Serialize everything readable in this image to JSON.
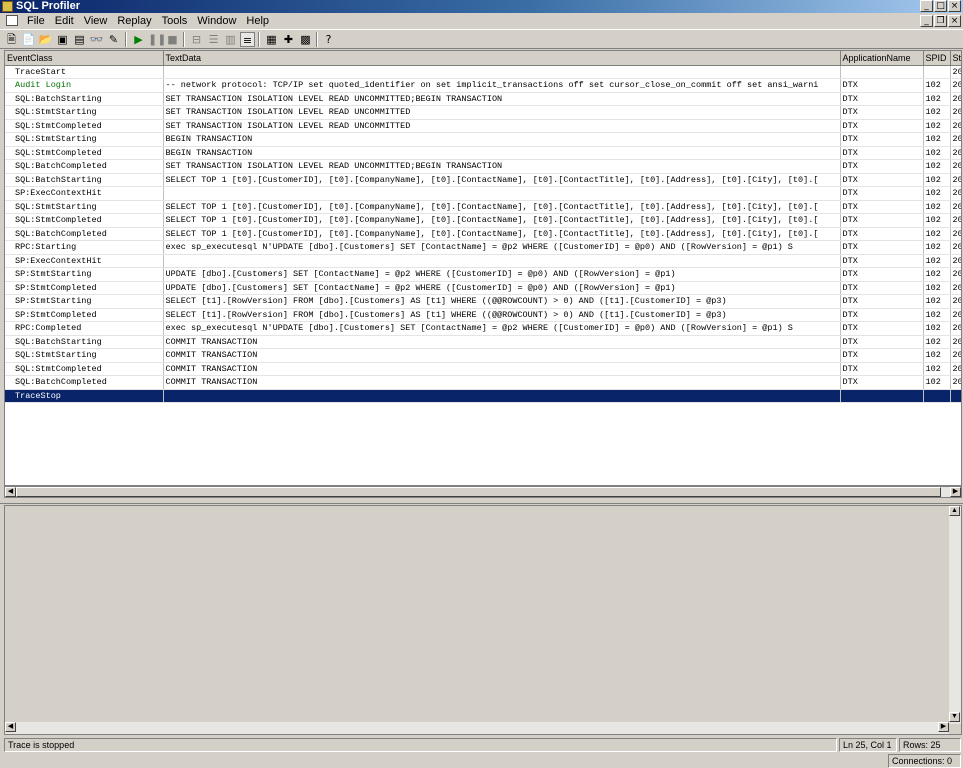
{
  "window": {
    "title": "SQL Profiler"
  },
  "menu": [
    "File",
    "Edit",
    "View",
    "Replay",
    "Tools",
    "Window",
    "Help"
  ],
  "toolbar": {
    "icons": [
      "new-trace-icon",
      "new-template-icon",
      "open-icon",
      "save-icon",
      "properties-icon",
      "find-icon",
      "clear-icon",
      "start-icon",
      "pause-icon",
      "stop-icon",
      "step-icon",
      "group-icon",
      "ungroup-icon",
      "auto-scroll-icon",
      "query-analyzer-icon",
      "perfmon-icon",
      "clear-window-icon",
      "help-icon"
    ]
  },
  "grid": {
    "columns": [
      "EventClass",
      "TextData",
      "ApplicationName",
      "SPID",
      "St"
    ],
    "rows": [
      {
        "event": "TraceStart",
        "text": "",
        "app": "",
        "spid": "",
        "st": "20"
      },
      {
        "event": "Audit Login",
        "text": "-- network protocol: TCP/IP set quoted_identifier on set implicit_transactions off set cursor_close_on_commit off set ansi_warni",
        "app": "DTX",
        "spid": "102",
        "st": "20"
      },
      {
        "event": "SQL:BatchStarting",
        "text": "SET TRANSACTION ISOLATION LEVEL READ UNCOMMITTED;BEGIN TRANSACTION",
        "app": "DTX",
        "spid": "102",
        "st": "20"
      },
      {
        "event": "SQL:StmtStarting",
        "text": "SET TRANSACTION ISOLATION LEVEL READ UNCOMMITTED",
        "app": "DTX",
        "spid": "102",
        "st": "20"
      },
      {
        "event": "SQL:StmtCompleted",
        "text": "SET TRANSACTION ISOLATION LEVEL READ UNCOMMITTED",
        "app": "DTX",
        "spid": "102",
        "st": "20"
      },
      {
        "event": "SQL:StmtStarting",
        "text": "BEGIN TRANSACTION",
        "app": "DTX",
        "spid": "102",
        "st": "20"
      },
      {
        "event": "SQL:StmtCompleted",
        "text": "BEGIN TRANSACTION",
        "app": "DTX",
        "spid": "102",
        "st": "20"
      },
      {
        "event": "SQL:BatchCompleted",
        "text": "SET TRANSACTION ISOLATION LEVEL READ UNCOMMITTED;BEGIN TRANSACTION",
        "app": "DTX",
        "spid": "102",
        "st": "20"
      },
      {
        "event": "SQL:BatchStarting",
        "text": "SELECT TOP 1 [t0].[CustomerID], [t0].[CompanyName], [t0].[ContactName], [t0].[ContactTitle], [t0].[Address], [t0].[City], [t0].[",
        "app": "DTX",
        "spid": "102",
        "st": "20"
      },
      {
        "event": "SP:ExecContextHit",
        "text": "",
        "app": "DTX",
        "spid": "102",
        "st": "20"
      },
      {
        "event": "SQL:StmtStarting",
        "text": "SELECT TOP 1 [t0].[CustomerID], [t0].[CompanyName], [t0].[ContactName], [t0].[ContactTitle], [t0].[Address], [t0].[City], [t0].[",
        "app": "DTX",
        "spid": "102",
        "st": "20"
      },
      {
        "event": "SQL:StmtCompleted",
        "text": "SELECT TOP 1 [t0].[CustomerID], [t0].[CompanyName], [t0].[ContactName], [t0].[ContactTitle], [t0].[Address], [t0].[City], [t0].[",
        "app": "DTX",
        "spid": "102",
        "st": "20"
      },
      {
        "event": "SQL:BatchCompleted",
        "text": "SELECT TOP 1 [t0].[CustomerID], [t0].[CompanyName], [t0].[ContactName], [t0].[ContactTitle], [t0].[Address], [t0].[City], [t0].[",
        "app": "DTX",
        "spid": "102",
        "st": "20"
      },
      {
        "event": "RPC:Starting",
        "text": "exec sp_executesql N'UPDATE [dbo].[Customers]  SET [ContactName] = @p2  WHERE ([CustomerID] = @p0) AND ([RowVersion] = @p1)    S",
        "app": "DTX",
        "spid": "102",
        "st": "20"
      },
      {
        "event": "SP:ExecContextHit",
        "text": "",
        "app": "DTX",
        "spid": "102",
        "st": "20"
      },
      {
        "event": "SP:StmtStarting",
        "text": "UPDATE [dbo].[Customers]  SET [ContactName] = @p2  WHERE ([CustomerID] = @p0) AND ([RowVersion] = @p1)",
        "app": "DTX",
        "spid": "102",
        "st": "20"
      },
      {
        "event": "SP:StmtCompleted",
        "text": "UPDATE [dbo].[Customers]  SET [ContactName] = @p2  WHERE ([CustomerID] = @p0) AND ([RowVersion] = @p1)",
        "app": "DTX",
        "spid": "102",
        "st": "20"
      },
      {
        "event": "SP:StmtStarting",
        "text": "SELECT [t1].[RowVersion]  FROM [dbo].[Customers] AS [t1]  WHERE ((@@ROWCOUNT) > 0) AND ([t1].[CustomerID] = @p3)",
        "app": "DTX",
        "spid": "102",
        "st": "20"
      },
      {
        "event": "SP:StmtCompleted",
        "text": "SELECT [t1].[RowVersion]  FROM [dbo].[Customers] AS [t1]  WHERE ((@@ROWCOUNT) > 0) AND ([t1].[CustomerID] = @p3)",
        "app": "DTX",
        "spid": "102",
        "st": "20"
      },
      {
        "event": "RPC:Completed",
        "text": "exec sp_executesql N'UPDATE [dbo].[Customers]  SET [ContactName] = @p2  WHERE ([CustomerID] = @p0) AND ([RowVersion] = @p1)    S",
        "app": "DTX",
        "spid": "102",
        "st": "20"
      },
      {
        "event": "SQL:BatchStarting",
        "text": "COMMIT TRANSACTION",
        "app": "DTX",
        "spid": "102",
        "st": "20"
      },
      {
        "event": "SQL:StmtStarting",
        "text": "COMMIT TRANSACTION",
        "app": "DTX",
        "spid": "102",
        "st": "20"
      },
      {
        "event": "SQL:StmtCompleted",
        "text": "COMMIT TRANSACTION",
        "app": "DTX",
        "spid": "102",
        "st": "20"
      },
      {
        "event": "SQL:BatchCompleted",
        "text": "COMMIT TRANSACTION",
        "app": "DTX",
        "spid": "102",
        "st": "20"
      },
      {
        "event": "TraceStop",
        "text": "",
        "app": "",
        "spid": "",
        "st": ""
      }
    ],
    "selected_row": 24,
    "green_row": 1
  },
  "status": {
    "message": "Trace is stopped",
    "position": "Ln 25, Col 1",
    "rows": "Rows: 25",
    "connections": "Connections: 0"
  },
  "colors": {
    "selection": "#0a246a",
    "audit_login": "#007000",
    "chrome": "#d4d0c8"
  }
}
